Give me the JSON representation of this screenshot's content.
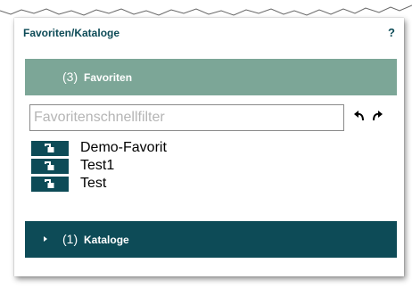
{
  "panel": {
    "title": "Favoriten/Kataloge",
    "help_label": "?"
  },
  "favorites_section": {
    "count": "(3)",
    "label": "Favoriten"
  },
  "filter": {
    "placeholder": "Favoritenschnellfilter",
    "value": ""
  },
  "favorites": [
    {
      "name": "Demo-Favorit",
      "icon": "unlock-icon"
    },
    {
      "name": "Test1",
      "icon": "unlock-icon"
    },
    {
      "name": "Test",
      "icon": "unlock-icon"
    }
  ],
  "catalogs_section": {
    "count": "(1)",
    "label": "Kataloge"
  },
  "colors": {
    "dark_teal": "#0d4b57",
    "sage_green": "#7ca697"
  }
}
